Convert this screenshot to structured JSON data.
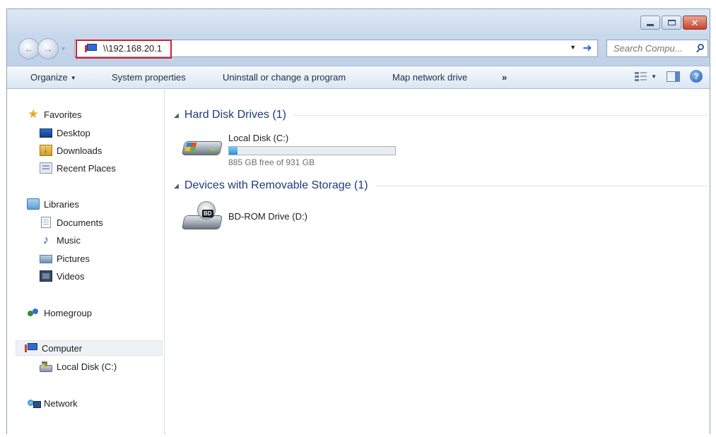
{
  "address": {
    "path": "\\\\192.168.20.1"
  },
  "search": {
    "placeholder": "Search Compu..."
  },
  "toolbar": {
    "organize": "Organize",
    "system_properties": "System properties",
    "uninstall": "Uninstall or change a program",
    "map_network_drive": "Map network drive",
    "more": "»"
  },
  "nav": {
    "favorites": "Favorites",
    "desktop": "Desktop",
    "downloads": "Downloads",
    "recent_places": "Recent Places",
    "libraries": "Libraries",
    "documents": "Documents",
    "music": "Music",
    "pictures": "Pictures",
    "videos": "Videos",
    "homegroup": "Homegroup",
    "computer": "Computer",
    "local_disk": "Local Disk (C:)",
    "network": "Network"
  },
  "sections": {
    "hard_disks": {
      "title": "Hard Disk Drives (1)"
    },
    "removable": {
      "title": "Devices with Removable Storage (1)"
    }
  },
  "drives": {
    "c": {
      "name": "Local Disk (C:)",
      "free_text": "885 GB free of 931 GB",
      "used_fraction": 0.05
    },
    "d": {
      "name": "BD-ROM Drive (D:)",
      "badge": "BD"
    }
  },
  "icons": {
    "back": "back-arrow-icon",
    "forward": "forward-arrow-icon",
    "go": "go-arrow-icon",
    "search": "search-icon",
    "views": "change-view-icon",
    "preview_pane": "preview-pane-icon",
    "help": "help-icon"
  },
  "colors": {
    "address_highlight": "#d11f2a",
    "section_title": "#1e3b7a",
    "usage_fill": "#2a8fd4"
  }
}
